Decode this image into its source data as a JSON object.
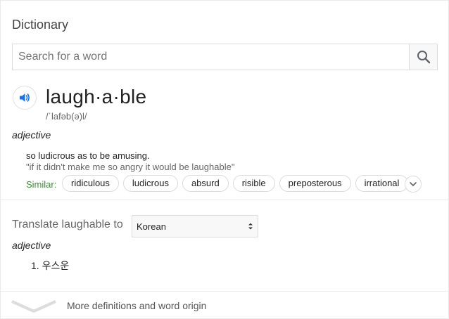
{
  "app": {
    "title": "Dictionary"
  },
  "search": {
    "placeholder": "Search for a word",
    "value": "",
    "button_icon": "search-icon"
  },
  "entry": {
    "headword": "laugh·a·ble",
    "phonetic": "/ˈlafəb(ə)l/",
    "audio_icon": "speaker-icon",
    "part_of_speech": "adjective",
    "definition": "so ludicrous as to be amusing.",
    "example": "\"if it didn't make me so angry it would be laughable\"",
    "similar_label": "Similar:",
    "similar": [
      "ridiculous",
      "ludicrous",
      "absurd",
      "risible",
      "preposterous",
      "irrational"
    ]
  },
  "translate": {
    "label": "Translate laughable to",
    "language": "Korean",
    "part_of_speech": "adjective",
    "items": [
      "1. 우스운"
    ]
  },
  "footer": {
    "label": "More definitions and word origin"
  },
  "colors": {
    "accent": "#1a73e8",
    "similar_label": "#3c8c3c",
    "border": "#dcdcdc"
  }
}
